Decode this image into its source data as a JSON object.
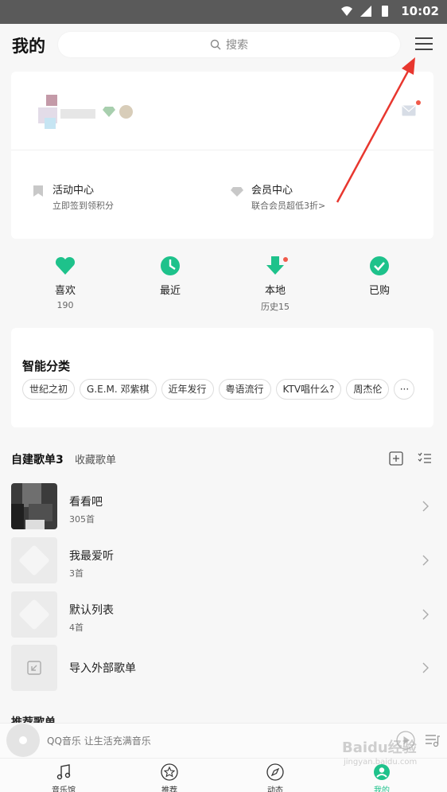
{
  "status_bar": {
    "time": "10:02"
  },
  "header": {
    "title": "我的",
    "search_placeholder": "搜索"
  },
  "entries": {
    "activity": {
      "title": "活动中心",
      "subtitle": "立即签到领积分"
    },
    "vip": {
      "title": "会员中心",
      "subtitle": "联合会员超低3折>"
    }
  },
  "quick_actions": [
    {
      "label": "喜欢",
      "count": "190",
      "icon": "heart-icon"
    },
    {
      "label": "最近",
      "count": "",
      "icon": "clock-icon"
    },
    {
      "label": "本地",
      "count": "历史15",
      "icon": "download-icon"
    },
    {
      "label": "已购",
      "count": "",
      "icon": "check-icon"
    }
  ],
  "smart_category": {
    "title": "智能分类",
    "tags": [
      "世纪之初",
      "G.E.M. 邓紫棋",
      "近年发行",
      "粤语流行",
      "KTV唱什么?",
      "周杰伦"
    ],
    "more": "···"
  },
  "playlists": {
    "tab_created": "自建歌单3",
    "tab_collected": "收藏歌单",
    "items": [
      {
        "name": "看看吧",
        "count": "305首"
      },
      {
        "name": "我最爱听",
        "count": "3首"
      },
      {
        "name": "默认列表",
        "count": "4首"
      }
    ],
    "import_label": "导入外部歌单"
  },
  "recommend_peek": "推荐歌单",
  "player": {
    "text": "QQ音乐 让生活充满音乐"
  },
  "nav": [
    {
      "label": "音乐馆",
      "icon": "music-note-icon"
    },
    {
      "label": "推荐",
      "icon": "star-icon"
    },
    {
      "label": "动态",
      "icon": "compass-icon"
    },
    {
      "label": "我的",
      "icon": "profile-icon"
    }
  ],
  "colors": {
    "accent": "#1ec28b",
    "arrow": "#e8372f",
    "dot": "#f05a4a"
  },
  "watermark": {
    "main": "Baidu经验",
    "sub": "jingyan.baidu.com"
  }
}
